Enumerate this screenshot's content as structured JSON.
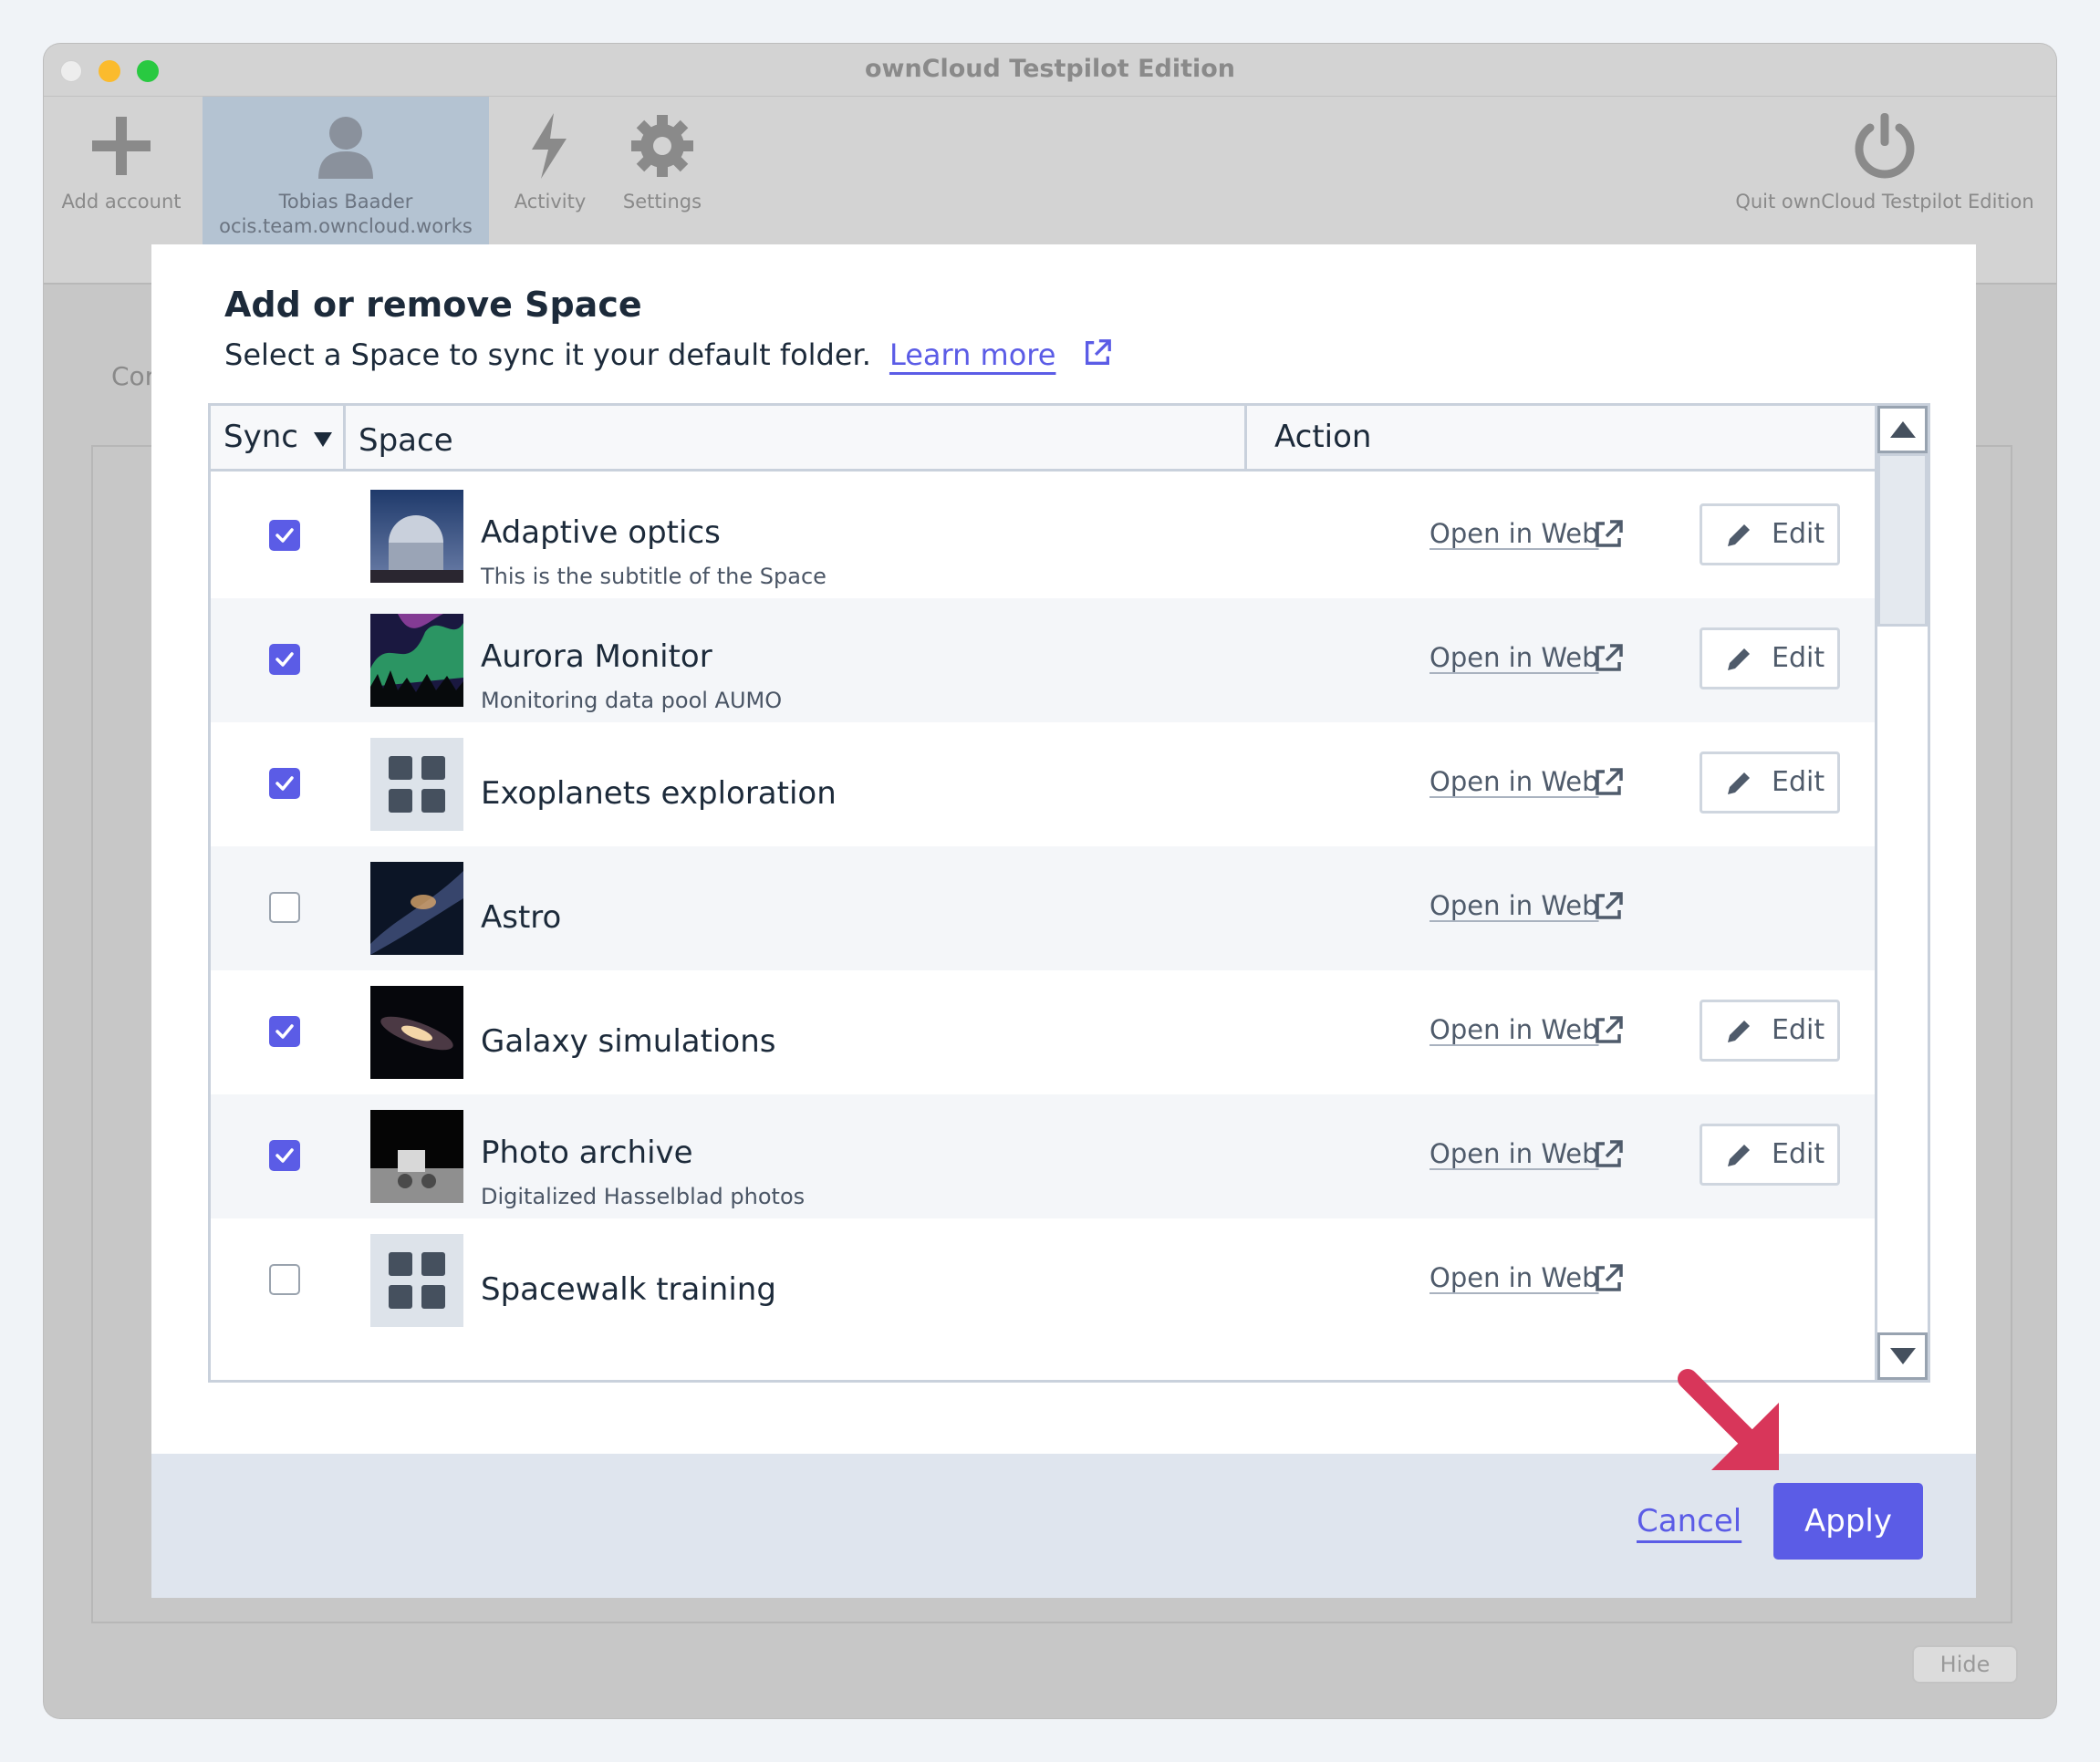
{
  "window": {
    "title": "ownCloud Testpilot Edition",
    "colors": {
      "close": "#ededed",
      "minimize": "#fbbb2d",
      "zoom": "#29c941"
    }
  },
  "toolbar": {
    "add_account": "Add account",
    "account_name": "Tobias Baader",
    "account_server": "ocis.team.owncloud.works",
    "activity": "Activity",
    "settings": "Settings",
    "quit": "Quit ownCloud Testpilot Edition"
  },
  "background": {
    "connection_label_partial": "Cor",
    "hide_button": "Hide"
  },
  "dialog": {
    "title": "Add or remove Space",
    "subtitle": "Select a Space to sync it your default folder.",
    "learn_more": "Learn more",
    "accent_color": "#5b5ce6",
    "table": {
      "headers": {
        "sync": "Sync",
        "space": "Space",
        "action": "Action"
      },
      "sort_indicator": "sort-descending-icon",
      "rows": [
        {
          "name": "Adaptive optics",
          "subtitle": "This is the subtitle of the Space",
          "synced": true,
          "open_web": "Open in Web",
          "edit": "Edit",
          "thumb": "observatory-image"
        },
        {
          "name": "Aurora Monitor",
          "subtitle": "Monitoring data pool AUMO",
          "synced": true,
          "open_web": "Open in Web",
          "edit": "Edit",
          "thumb": "aurora-image"
        },
        {
          "name": "Exoplanets exploration",
          "subtitle": "",
          "synced": true,
          "open_web": "Open in Web",
          "edit": "Edit",
          "thumb": "default-space-icon"
        },
        {
          "name": "Astro",
          "subtitle": "",
          "synced": false,
          "open_web": "Open in Web",
          "edit": "",
          "thumb": "milky-way-image"
        },
        {
          "name": "Galaxy simulations",
          "subtitle": "",
          "synced": true,
          "open_web": "Open in Web",
          "edit": "Edit",
          "thumb": "galaxy-image"
        },
        {
          "name": "Photo archive",
          "subtitle": "Digitalized Hasselblad photos",
          "synced": true,
          "open_web": "Open in Web",
          "edit": "Edit",
          "thumb": "moon-rover-image"
        },
        {
          "name": "Spacewalk training",
          "subtitle": "",
          "synced": false,
          "open_web": "Open in Web",
          "edit": "",
          "thumb": "default-space-icon"
        }
      ]
    },
    "footer": {
      "cancel": "Cancel",
      "apply": "Apply"
    }
  },
  "annotation": {
    "color": "#d8365a",
    "points_to": "apply-button"
  }
}
